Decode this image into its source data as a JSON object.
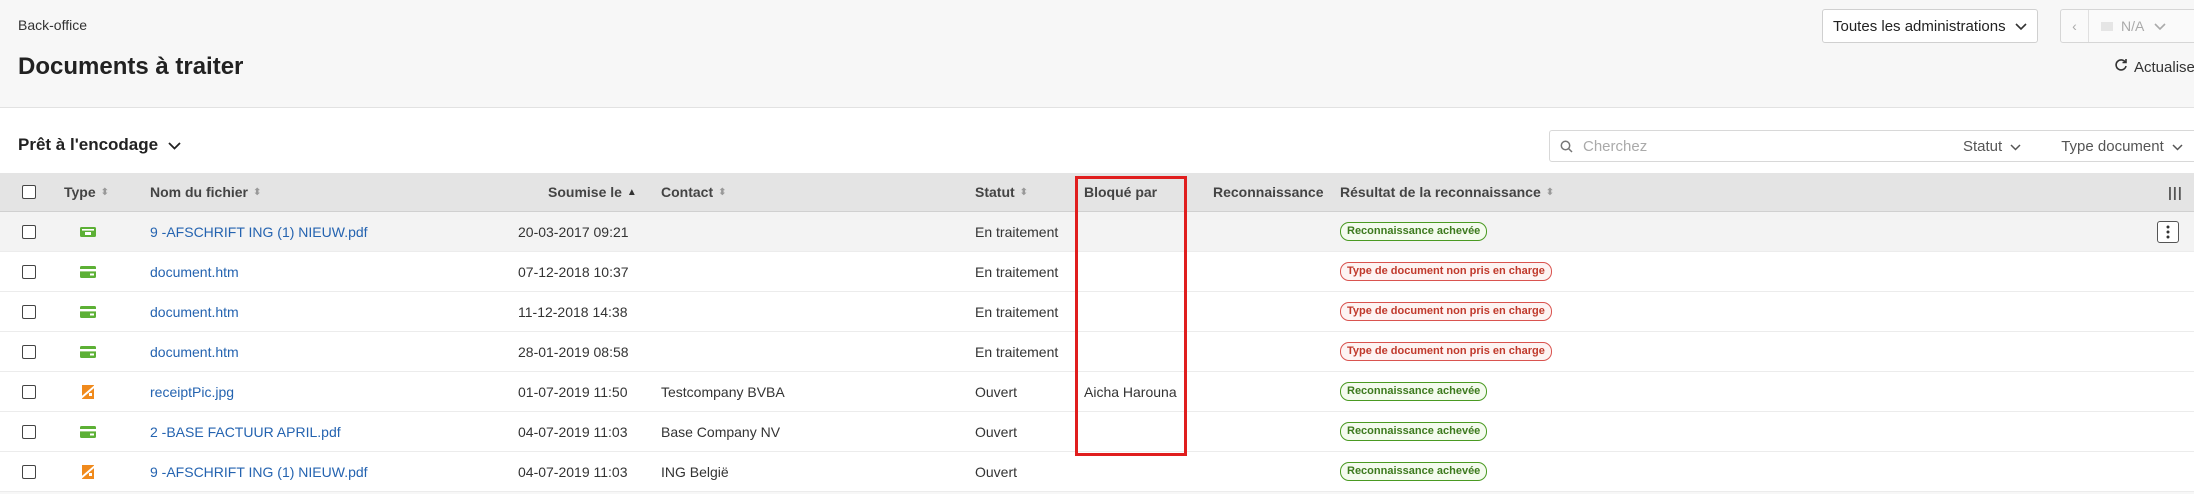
{
  "header": {
    "breadcrumb": "Back-office",
    "title": "Documents à traiter",
    "admin_select": "Toutes les administrations",
    "pager_prev": "‹",
    "pager_value": "N/A",
    "refresh_label": "Actualiser"
  },
  "toolbar": {
    "filter_label": "Prêt à l'encodage",
    "search_placeholder": "Cherchez",
    "status_filter": "Statut",
    "type_filter": "Type document"
  },
  "table": {
    "columns": {
      "type": "Type",
      "filename": "Nom du fichier",
      "submitted": "Soumise le",
      "contact": "Contact",
      "status": "Statut",
      "blocked_by": "Bloqué par",
      "recognition": "Reconnaissance",
      "recognition_result": "Résultat de la reconnaissance"
    },
    "rows": [
      {
        "icon": "invoice-icon",
        "filename": "9 -AFSCHRIFT ING (1) NIEUW.pdf",
        "submitted": "20-03-2017 09:21",
        "contact": "",
        "status": "En traitement",
        "blocked_by": "",
        "result": "Reconnaissance achevée",
        "result_kind": "ok"
      },
      {
        "icon": "bank-card-icon",
        "filename": "document.htm",
        "submitted": "07-12-2018 10:37",
        "contact": "",
        "status": "En traitement",
        "blocked_by": "",
        "result": "Type de document non pris en charge",
        "result_kind": "err"
      },
      {
        "icon": "bank-card-icon",
        "filename": "document.htm",
        "submitted": "11-12-2018 14:38",
        "contact": "",
        "status": "En traitement",
        "blocked_by": "",
        "result": "Type de document non pris en charge",
        "result_kind": "err"
      },
      {
        "icon": "bank-card-icon",
        "filename": "document.htm",
        "submitted": "28-01-2019 08:58",
        "contact": "",
        "status": "En traitement",
        "blocked_by": "",
        "result": "Type de document non pris en charge",
        "result_kind": "err"
      },
      {
        "icon": "receipt-icon",
        "filename": "receiptPic.jpg",
        "submitted": "01-07-2019 11:50",
        "contact": "Testcompany BVBA",
        "status": "Ouvert",
        "blocked_by": "Aicha Harouna",
        "result": "Reconnaissance achevée",
        "result_kind": "ok"
      },
      {
        "icon": "bank-card-icon",
        "filename": "2 -BASE FACTUUR APRIL.pdf",
        "submitted": "04-07-2019 11:03",
        "contact": "Base Company NV",
        "status": "Ouvert",
        "blocked_by": "",
        "result": "Reconnaissance achevée",
        "result_kind": "ok"
      },
      {
        "icon": "receipt-icon",
        "filename": "9 -AFSCHRIFT ING (1) NIEUW.pdf",
        "submitted": "04-07-2019 11:03",
        "contact": "ING België",
        "status": "Ouvert",
        "blocked_by": "",
        "result": "Reconnaissance achevée",
        "result_kind": "ok"
      }
    ]
  },
  "colors": {
    "link": "#2463b0",
    "ok_badge": "#4a9a22",
    "err_badge": "#d9534f",
    "highlight": "#e01e1e",
    "icon_green": "#5cb035",
    "icon_orange": "#f08a1c"
  }
}
